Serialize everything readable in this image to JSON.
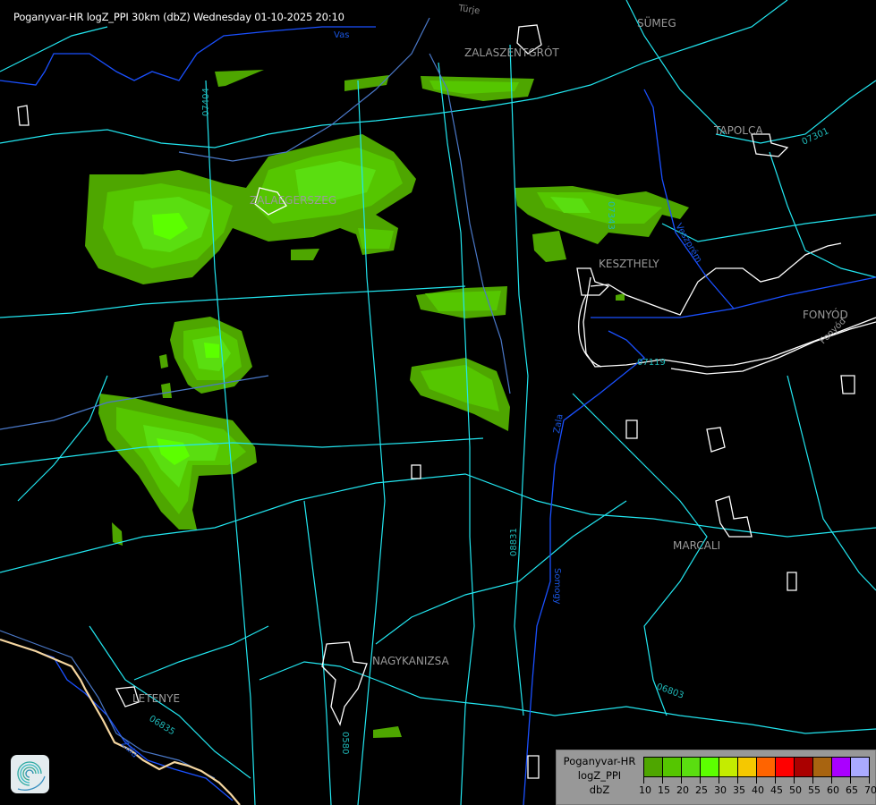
{
  "header": {
    "title": "Poganyvar-HR logZ_PPI 30km (dbZ) Wednesday 01-10-2025 20:10"
  },
  "map": {
    "places": [
      "SÜMEG",
      "ZALASZENTGRÓT",
      "TAPOLCA",
      "ZALAEGERSZEG",
      "KESZTHELY",
      "FONYÓD",
      "MARCALI",
      "NAGYKANIZSA",
      "LETENYE"
    ],
    "road_numbers": [
      "07404",
      "07343",
      "07301",
      "07119",
      "08831",
      "06803",
      "06835",
      "0580"
    ],
    "rivers": [
      "Vas",
      "Türje",
      "Veszprém",
      "Zala",
      "Somogy",
      "Fonyód",
      "Zala"
    ],
    "colors": {
      "background": "#000000",
      "roads": "#22e6f0",
      "rivers": "#1a50ff",
      "settlements": "#ffffff",
      "border": "#f5d6a0"
    }
  },
  "legend": {
    "line1": "Poganyvar-HR",
    "line2": "logZ_PPI",
    "line3": "dbZ",
    "ticks": [
      "10",
      "15",
      "20",
      "25",
      "30",
      "35",
      "40",
      "45",
      "50",
      "55",
      "60",
      "65",
      "70"
    ],
    "colors": [
      "#4ea600",
      "#55c600",
      "#5ade10",
      "#5cff00",
      "#c4ec00",
      "#f5c800",
      "#ff6400",
      "#ff0000",
      "#aa0000",
      "#a86410",
      "#aa00ff",
      "#aaaaff"
    ]
  },
  "logo": {
    "icon": "swirl-logo-icon"
  }
}
